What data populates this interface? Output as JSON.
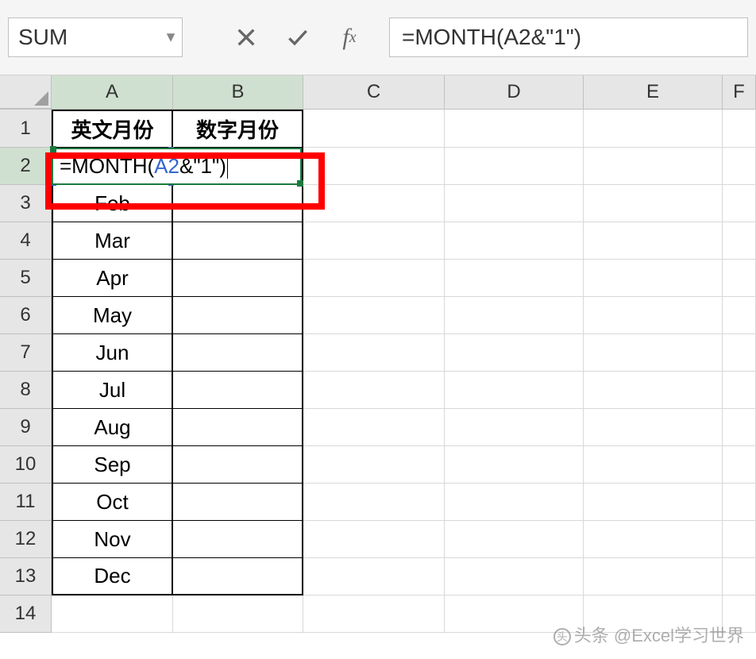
{
  "formula_bar": {
    "name_box": "SUM",
    "formula_prefix": "=MONTH(",
    "formula_ref": "A2",
    "formula_suffix": "&\"1\")",
    "formula_full": "=MONTH(A2&\"1\")"
  },
  "columns": [
    "A",
    "B",
    "C",
    "D",
    "E",
    "F"
  ],
  "selected_columns": [
    "A",
    "B"
  ],
  "row_numbers": [
    "1",
    "2",
    "3",
    "4",
    "5",
    "6",
    "7",
    "8",
    "9",
    "10",
    "11",
    "12",
    "13",
    "14"
  ],
  "selected_row": "2",
  "headers": {
    "col_a": "英文月份",
    "col_b": "数字月份"
  },
  "editing_cell": {
    "address": "B2",
    "prefix": "=MONTH(",
    "ref": "A2",
    "suffix": "&\"1\")"
  },
  "data_rows": [
    {
      "a": "Feb",
      "b": ""
    },
    {
      "a": "Mar",
      "b": ""
    },
    {
      "a": "Apr",
      "b": ""
    },
    {
      "a": "May",
      "b": ""
    },
    {
      "a": "Jun",
      "b": ""
    },
    {
      "a": "Jul",
      "b": ""
    },
    {
      "a": "Aug",
      "b": ""
    },
    {
      "a": "Sep",
      "b": ""
    },
    {
      "a": "Oct",
      "b": ""
    },
    {
      "a": "Nov",
      "b": ""
    },
    {
      "a": "Dec",
      "b": ""
    }
  ],
  "watermark": "头条 @Excel学习世界"
}
